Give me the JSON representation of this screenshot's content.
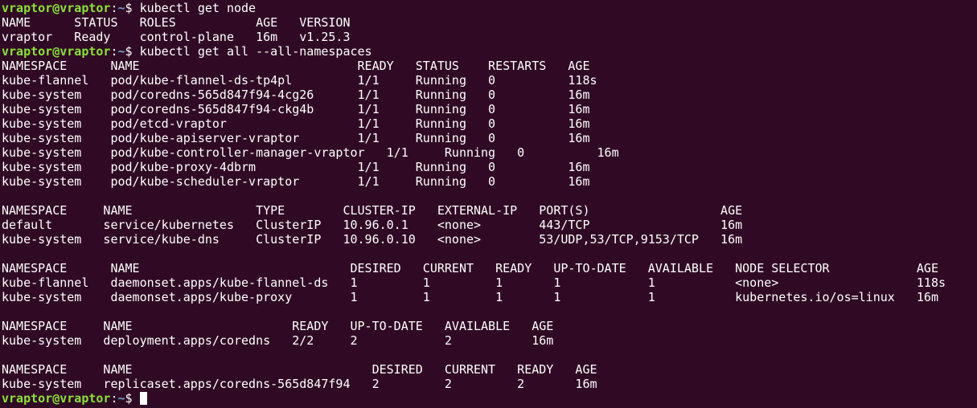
{
  "colors": {
    "background": "#300a24",
    "foreground": "#ffffff",
    "prompt_user": "#8ae234",
    "prompt_path": "#729fcf"
  },
  "lines": [
    {
      "type": "prompt",
      "user": "vraptor@vraptor",
      "sep": ":",
      "path": "~",
      "sym": "$ ",
      "cmd": "kubectl get node"
    },
    {
      "type": "output",
      "text": "NAME      STATUS   ROLES           AGE   VERSION"
    },
    {
      "type": "output",
      "text": "vraptor   Ready    control-plane   16m   v1.25.3"
    },
    {
      "type": "prompt",
      "user": "vraptor@vraptor",
      "sep": ":",
      "path": "~",
      "sym": "$ ",
      "cmd": "kubectl get all --all-namespaces"
    },
    {
      "type": "output",
      "text": "NAMESPACE      NAME                              READY   STATUS    RESTARTS   AGE"
    },
    {
      "type": "output",
      "text": "kube-flannel   pod/kube-flannel-ds-tp4pl         1/1     Running   0          118s"
    },
    {
      "type": "output",
      "text": "kube-system    pod/coredns-565d847f94-4cg26      1/1     Running   0          16m"
    },
    {
      "type": "output",
      "text": "kube-system    pod/coredns-565d847f94-ckg4b      1/1     Running   0          16m"
    },
    {
      "type": "output",
      "text": "kube-system    pod/etcd-vraptor                  1/1     Running   0          16m"
    },
    {
      "type": "output",
      "text": "kube-system    pod/kube-apiserver-vraptor        1/1     Running   0          16m"
    },
    {
      "type": "output",
      "text": "kube-system    pod/kube-controller-manager-vraptor   1/1     Running   0          16m"
    },
    {
      "type": "output",
      "text": "kube-system    pod/kube-proxy-4dbrm              1/1     Running   0          16m"
    },
    {
      "type": "output",
      "text": "kube-system    pod/kube-scheduler-vraptor        1/1     Running   0          16m"
    },
    {
      "type": "output",
      "text": ""
    },
    {
      "type": "output",
      "text": "NAMESPACE     NAME                 TYPE        CLUSTER-IP   EXTERNAL-IP   PORT(S)                  AGE"
    },
    {
      "type": "output",
      "text": "default       service/kubernetes   ClusterIP   10.96.0.1    <none>        443/TCP                  16m"
    },
    {
      "type": "output",
      "text": "kube-system   service/kube-dns     ClusterIP   10.96.0.10   <none>        53/UDP,53/TCP,9153/TCP   16m"
    },
    {
      "type": "output",
      "text": ""
    },
    {
      "type": "output",
      "text": "NAMESPACE      NAME                             DESIRED   CURRENT   READY   UP-TO-DATE   AVAILABLE   NODE SELECTOR            AGE"
    },
    {
      "type": "output",
      "text": "kube-flannel   daemonset.apps/kube-flannel-ds   1         1         1       1            1           <none>                   118s"
    },
    {
      "type": "output",
      "text": "kube-system    daemonset.apps/kube-proxy        1         1         1       1            1           kubernetes.io/os=linux   16m"
    },
    {
      "type": "output",
      "text": ""
    },
    {
      "type": "output",
      "text": "NAMESPACE     NAME                      READY   UP-TO-DATE   AVAILABLE   AGE"
    },
    {
      "type": "output",
      "text": "kube-system   deployment.apps/coredns   2/2     2            2           16m"
    },
    {
      "type": "output",
      "text": ""
    },
    {
      "type": "output",
      "text": "NAMESPACE     NAME                                 DESIRED   CURRENT   READY   AGE"
    },
    {
      "type": "output",
      "text": "kube-system   replicaset.apps/coredns-565d847f94   2         2         2       16m"
    },
    {
      "type": "prompt",
      "user": "vraptor@vraptor",
      "sep": ":",
      "path": "~",
      "sym": "$ ",
      "cmd": "",
      "cursor": true
    }
  ]
}
